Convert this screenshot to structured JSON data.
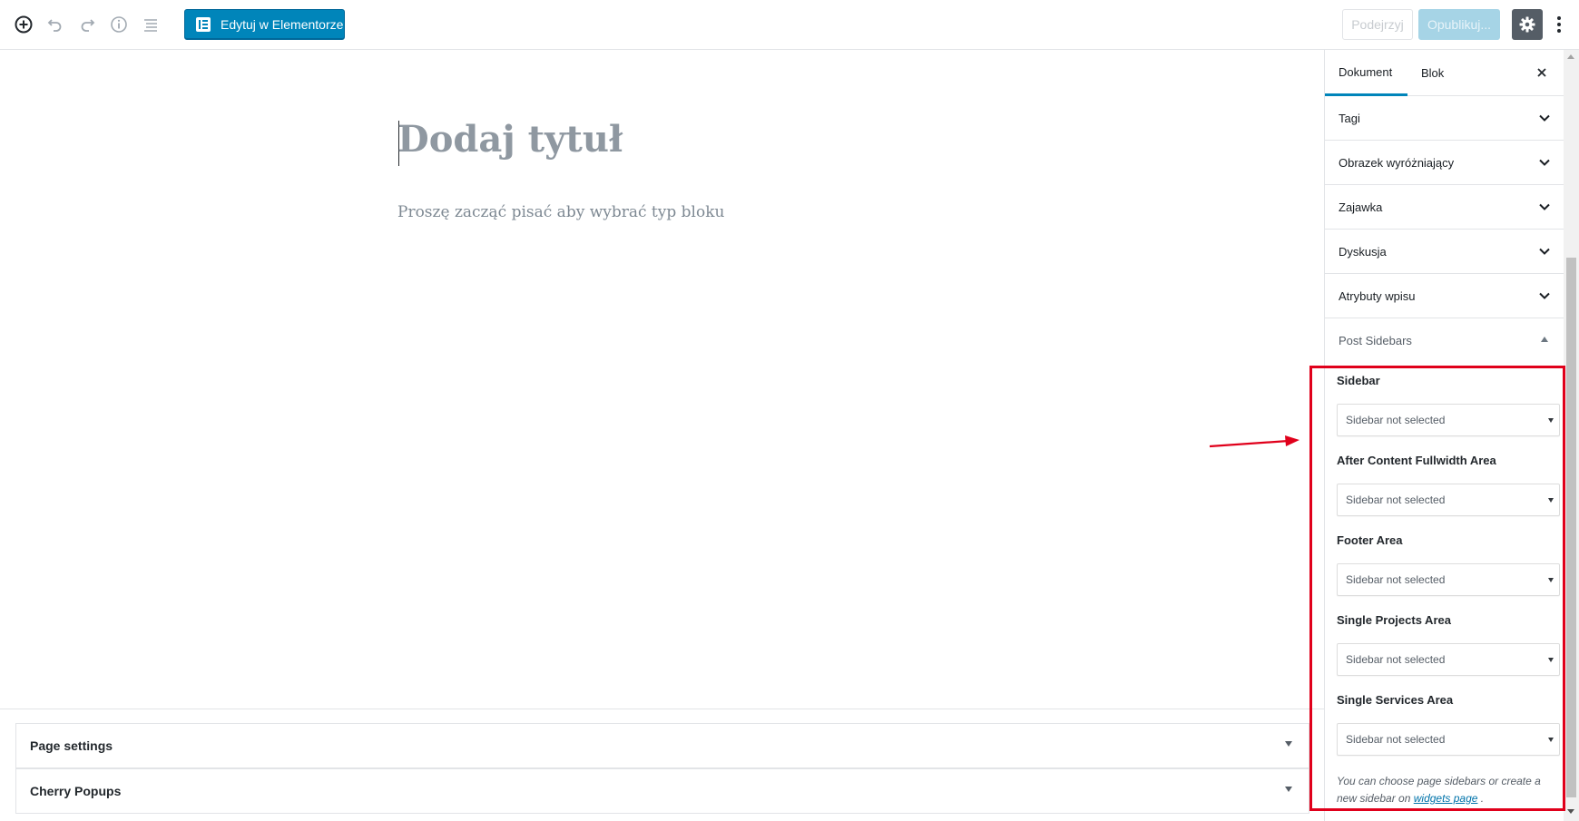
{
  "toolbar": {
    "add_block_icon": "plus-circle-icon",
    "undo_icon": "undo-icon",
    "redo_icon": "redo-icon",
    "info_icon": "info-icon",
    "outline_icon": "list-icon",
    "elementor_label": "Edytuj w Elementorze",
    "preview_label": "Podejrzyj",
    "publish_label": "Opublikuj...",
    "settings_icon": "gear-icon",
    "more_icon": "more-vertical-icon"
  },
  "editor": {
    "title_placeholder": "Dodaj tytuł",
    "block_placeholder": "Proszę zacząć pisać aby wybrać typ bloku"
  },
  "metaboxes": [
    {
      "label": "Page settings"
    },
    {
      "label": "Cherry Popups"
    }
  ],
  "sidebar": {
    "tabs": [
      "Dokument",
      "Blok"
    ],
    "active_tab": "Dokument",
    "panels": [
      "Tagi",
      "Obrazek wyróżniający",
      "Zajawka",
      "Dyskusja",
      "Atrybuty wpisu"
    ],
    "open_panel": "Post Sidebars",
    "fields": [
      {
        "label": "Sidebar",
        "value": "Sidebar not selected"
      },
      {
        "label": "After Content Fullwidth Area",
        "value": "Sidebar not selected"
      },
      {
        "label": "Footer Area",
        "value": "Sidebar not selected"
      },
      {
        "label": "Single Projects Area",
        "value": "Sidebar not selected"
      },
      {
        "label": "Single Services Area",
        "value": "Sidebar not selected"
      }
    ],
    "help_text_before": "You can choose page sidebars or create a new sidebar on",
    "help_link": "widgets page",
    "help_text_after": "."
  },
  "colors": {
    "accent": "#0085ba",
    "annotation": "#e0001b",
    "settings_active": "#555d66"
  }
}
